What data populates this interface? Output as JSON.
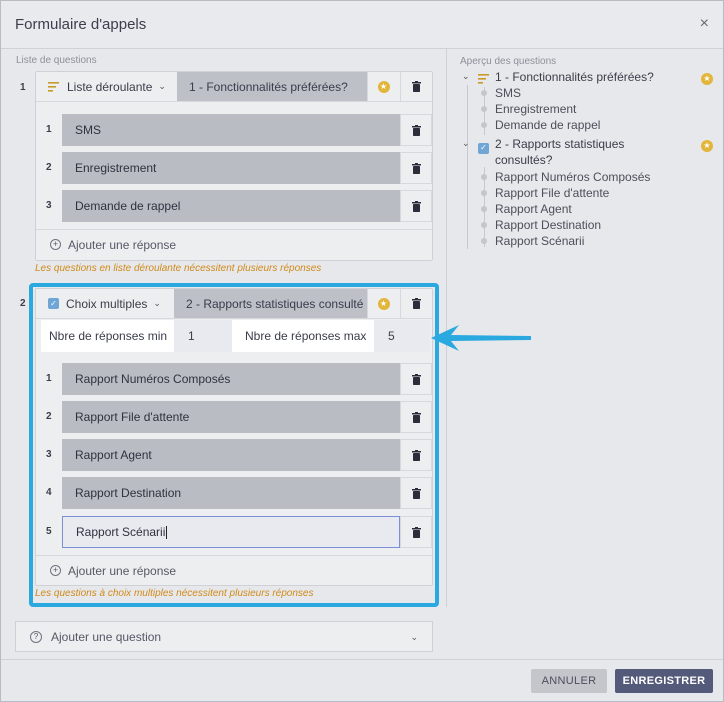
{
  "dialog": {
    "title": "Formulaire d'appels",
    "close_icon": "×"
  },
  "left": {
    "section_label": "Liste de questions",
    "questions": [
      {
        "number": "1",
        "type_label": "Liste déroulante",
        "title": "1 - Fonctionnalités préférées?",
        "answers": [
          {
            "number": "1",
            "text": "SMS"
          },
          {
            "number": "2",
            "text": "Enregistrement"
          },
          {
            "number": "3",
            "text": "Demande de rappel"
          }
        ],
        "add_answer": "Ajouter une réponse",
        "hint": "Les questions en liste déroulante nécessitent plusieurs réponses"
      },
      {
        "number": "2",
        "type_label": "Choix multiples",
        "title": "2 - Rapports statistiques consulté",
        "min_label": "Nbre de réponses min",
        "min_value": "1",
        "max_label": "Nbre de réponses max",
        "max_value": "5",
        "answers": [
          {
            "number": "1",
            "text": "Rapport Numéros Composés"
          },
          {
            "number": "2",
            "text": "Rapport File d'attente"
          },
          {
            "number": "3",
            "text": "Rapport Agent"
          },
          {
            "number": "4",
            "text": "Rapport Destination"
          },
          {
            "number": "5",
            "text": "Rapport Scénarii"
          }
        ],
        "add_answer": "Ajouter une réponse",
        "hint": "Les questions à choix multiples nécessitent plusieurs réponses"
      }
    ],
    "add_question": "Ajouter une question"
  },
  "preview": {
    "label": "Aperçu des questions",
    "q1": {
      "title": "1 - Fonctionnalités préférées?",
      "answers": [
        "SMS",
        "Enregistrement",
        "Demande de rappel"
      ]
    },
    "q2": {
      "title_line1": "2 - Rapports statistiques",
      "title_line2": "consultés?",
      "answers": [
        "Rapport Numéros Composés",
        "Rapport File d'attente",
        "Rapport Agent",
        "Rapport Destination",
        "Rapport Scénarii"
      ]
    }
  },
  "footer": {
    "cancel": "ANNULER",
    "save": "ENREGISTRER"
  },
  "colors": {
    "highlight": "#2aa9e0",
    "hint": "#cf8a1a",
    "star": "#e2b53b",
    "save_button": "#545a7a"
  }
}
